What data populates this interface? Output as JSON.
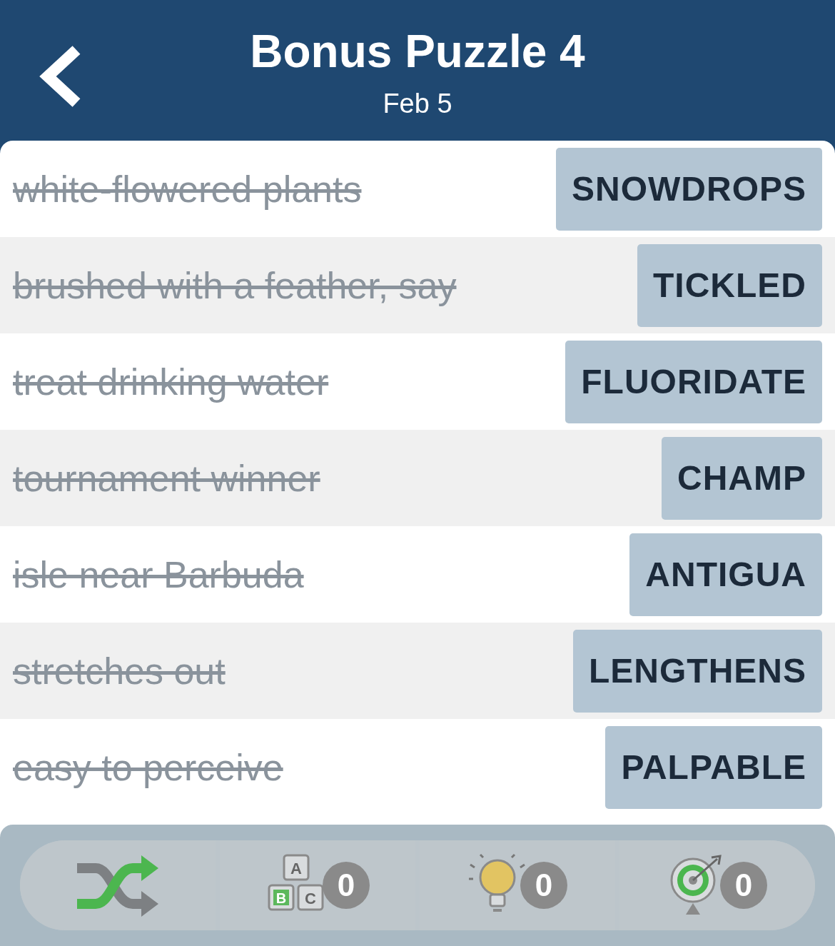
{
  "header": {
    "title": "Bonus Puzzle 4",
    "subtitle": "Feb 5"
  },
  "clues": [
    {
      "clue": "white-flowered plants",
      "answer": "SNOWDROPS",
      "solved": true
    },
    {
      "clue": "brushed with a feather, say",
      "answer": "TICKLED",
      "solved": true
    },
    {
      "clue": "treat drinking water",
      "answer": "FLUORIDATE",
      "solved": true
    },
    {
      "clue": "tournament winner",
      "answer": "CHAMP",
      "solved": true
    },
    {
      "clue": "isle near Barbuda",
      "answer": "ANTIGUA",
      "solved": true
    },
    {
      "clue": "stretches out",
      "answer": "LENGTHENS",
      "solved": true
    },
    {
      "clue": "easy to perceive",
      "answer": "PALPABLE",
      "solved": true
    }
  ],
  "toolbar": [
    {
      "kind": "shuffle"
    },
    {
      "kind": "letters",
      "count": "0",
      "letters": [
        "A",
        "B",
        "C"
      ]
    },
    {
      "kind": "hint",
      "count": "0"
    },
    {
      "kind": "target",
      "count": "0"
    }
  ]
}
